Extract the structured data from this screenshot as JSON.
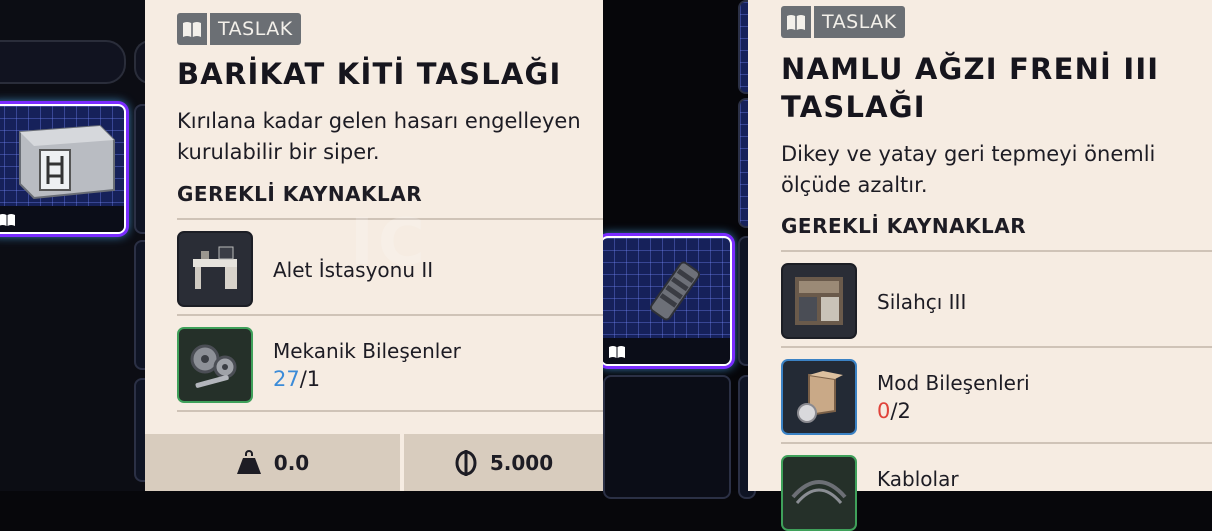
{
  "left_card": {
    "tag": "TASLAK",
    "title": "BARİKAT KİTİ TASLAĞI",
    "description": "Kırılana kadar gelen hasarı engelleyen kurulabilir bir siper.",
    "section_title": "GEREKLİ KAYNAKLAR",
    "resources": [
      {
        "name": "Alet İstasyonu II"
      },
      {
        "name": "Mekanik Bileşenler",
        "have": "27",
        "need": "/1"
      }
    ],
    "footer": {
      "weight": "0.0",
      "price": "5.000"
    }
  },
  "right_card": {
    "tag": "TASLAK",
    "title": "NAMLU AĞZI FRENİ III TASLAĞI",
    "description": "Dikey ve yatay geri tepmeyi önemli ölçüde azaltır.",
    "section_title": "GEREKLİ KAYNAKLAR",
    "resources": [
      {
        "name": "Silahçı III"
      },
      {
        "name": "Mod Bileşenleri",
        "have": "0",
        "need": "/2"
      },
      {
        "name": "Kablolar"
      }
    ]
  },
  "colors": {
    "card_bg": "#f6ece2",
    "tag_bg": "#6b6f74",
    "count_ok": "#3b8bd8",
    "count_missing": "#e0433a",
    "blueprint_slot": "#16215a",
    "slot_glow": "#7a2cff"
  },
  "icons": {
    "tag": "book-icon",
    "weight": "weight-icon",
    "currency": "coin-icon"
  }
}
